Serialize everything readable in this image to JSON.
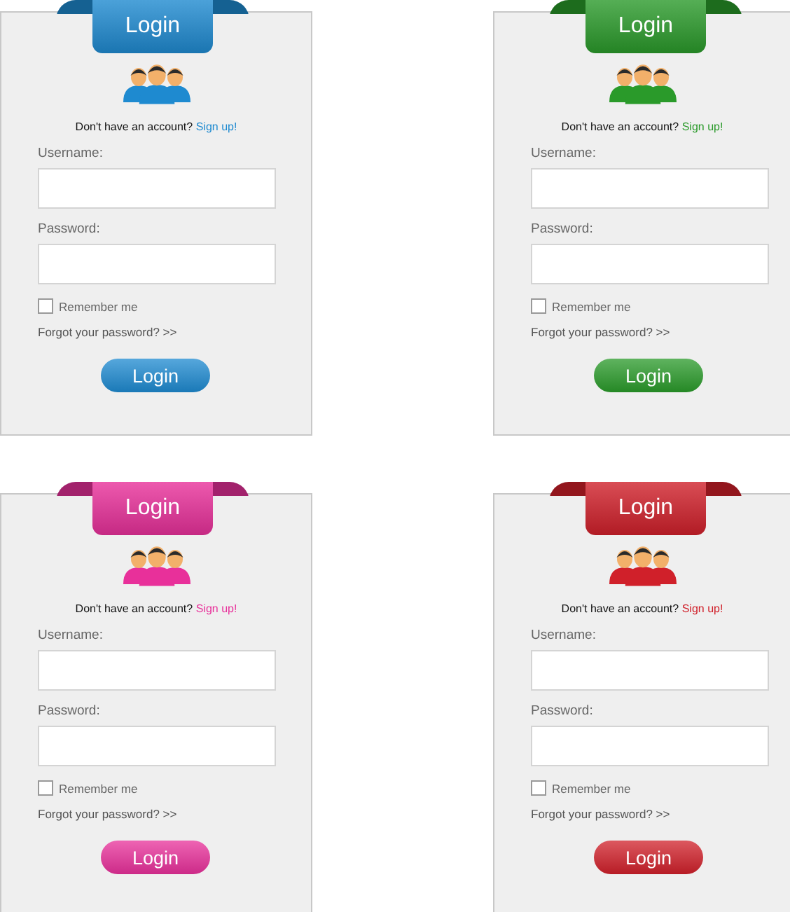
{
  "cards": [
    {
      "title": "Login",
      "color": "#1e8ad0",
      "prompt": "Don't have an account?",
      "signup": "Sign up!",
      "username_label": "Username:",
      "password_label": "Password:",
      "remember": {
        "label": "Remember me",
        "checked": false
      },
      "forgot": "Forgot your password? >>",
      "button": "Login"
    },
    {
      "title": "Login",
      "color": "#2a9a2a",
      "prompt": "Don't have an account?",
      "signup": "Sign up!",
      "username_label": "Username:",
      "password_label": "Password:",
      "remember": {
        "label": "Remember me",
        "checked": false
      },
      "forgot": "Forgot your password? >>",
      "button": "Login"
    },
    {
      "title": "Login",
      "color": "#e8309a",
      "prompt": "Don't have an account?",
      "signup": "Sign up!",
      "username_label": "Username:",
      "password_label": "Password:",
      "remember": {
        "label": "Remember me",
        "checked": false
      },
      "forgot": "Forgot your password? >>",
      "button": "Login"
    },
    {
      "title": "Login",
      "color": "#d0202a",
      "prompt": "Don't have an account?",
      "signup": "Sign up!",
      "username_label": "Username:",
      "password_label": "Password:",
      "remember": {
        "label": "Remember me",
        "checked": false
      },
      "forgot": "Forgot your password? >>",
      "button": "Login"
    }
  ]
}
